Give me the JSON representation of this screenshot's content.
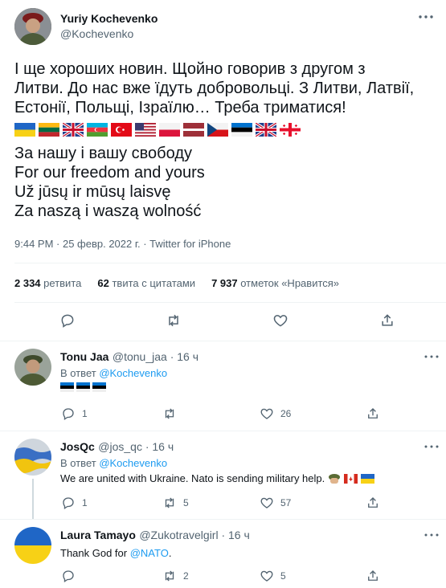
{
  "main": {
    "author_name": "Yuriy Kochevenko",
    "author_handle": "@Kochevenko",
    "text_line1": "І ще хороших новин. Щойно говорив з другом з",
    "text_line2": "Литви. До нас вже їдуть добровольці. З Литви, Латвії,",
    "text_line3": "Естонії, Польщі, Ізраїлю…  Треба триматися!",
    "flags": [
      "ukraine",
      "lithuania",
      "uk",
      "azerbaijan",
      "turkey",
      "usa",
      "poland",
      "latvia",
      "czech",
      "estonia",
      "uk",
      "georgia"
    ],
    "motto_uk": "За нашу і вашу свободу",
    "motto_en": "For our freedom and yours",
    "motto_lt": "Už jūsų ir mūsų laisvę",
    "motto_pl": "Za naszą i waszą wolność",
    "meta": "9:44 PM · 25 февр. 2022 г. · Twitter for iPhone",
    "retweets_count": "2 334",
    "retweets_label": "ретвита",
    "quotes_count": "62",
    "quotes_label": "твита с цитатами",
    "likes_count": "7 937",
    "likes_label": "отметок «Нравится»"
  },
  "replies": [
    {
      "name": "Tonu Jaa",
      "handle": "@tonu_jaa · 16 ч",
      "reply_to_prefix": "В ответ ",
      "reply_to_user": "@Kochevenko",
      "text": "",
      "flags": [
        "estonia",
        "estonia",
        "estonia"
      ],
      "reply_count": "1",
      "retweet_count": "",
      "like_count": "26"
    },
    {
      "name": "JosQc",
      "handle": "@jos_qc · 16 ч",
      "reply_to_prefix": "В ответ ",
      "reply_to_user": "@Kochevenko",
      "text": "We are united with Ukraine. Nato is sending military help.",
      "flags": [
        "soldier",
        "canada",
        "ukraine"
      ],
      "reply_count": "1",
      "retweet_count": "5",
      "like_count": "57"
    },
    {
      "name": "Laura Tamayo",
      "handle": "@Zukotravelgirl · 16 ч",
      "text_prefix": "Thank God for ",
      "text_link": "@NATO",
      "text_suffix": ".",
      "reply_count": "",
      "retweet_count": "2",
      "like_count": "5"
    }
  ],
  "icons": [
    "more-icon",
    "reply-icon",
    "retweet-icon",
    "like-icon",
    "share-icon"
  ]
}
